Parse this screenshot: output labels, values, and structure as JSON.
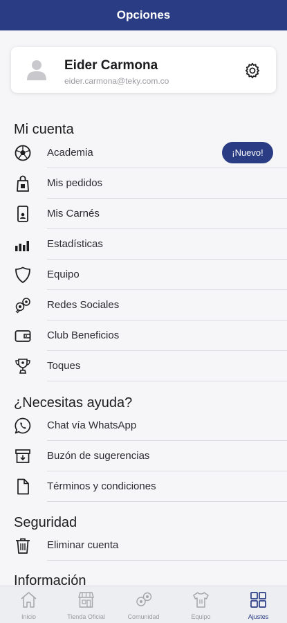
{
  "header": {
    "title": "Opciones"
  },
  "profile": {
    "name": "Eider Carmona",
    "email": "eider.carmona@teky.com.co",
    "avatar_icon": "user-icon",
    "settings_icon": "gear-icon"
  },
  "sections": {
    "mi_cuenta": {
      "title": "Mi cuenta",
      "items": [
        {
          "label": "Academia",
          "icon": "soccer-ball-icon",
          "badge": "¡Nuevo!"
        },
        {
          "label": "Mis pedidos",
          "icon": "shopping-bag-icon"
        },
        {
          "label": "Mis Carnés",
          "icon": "id-card-icon"
        },
        {
          "label": "Estadísticas",
          "icon": "bar-chart-icon"
        },
        {
          "label": "Equipo",
          "icon": "shield-icon"
        },
        {
          "label": "Redes Sociales",
          "icon": "social-network-icon"
        },
        {
          "label": "Club Beneficios",
          "icon": "wallet-icon"
        },
        {
          "label": "Toques",
          "icon": "trophy-icon"
        }
      ]
    },
    "ayuda": {
      "title": "¿Necesitas ayuda?",
      "items": [
        {
          "label": "Chat vía WhatsApp",
          "icon": "whatsapp-icon"
        },
        {
          "label": "Buzón de sugerencias",
          "icon": "inbox-icon"
        },
        {
          "label": "Términos y condiciones",
          "icon": "document-icon"
        }
      ]
    },
    "seguridad": {
      "title": "Seguridad",
      "items": [
        {
          "label": "Eliminar cuenta",
          "icon": "trash-icon"
        }
      ]
    },
    "informacion": {
      "title": "Información"
    }
  },
  "bottom_nav": {
    "active": "Ajustes",
    "tabs": [
      {
        "label": "Inicio",
        "icon": "home-icon"
      },
      {
        "label": "Tienda Oficial",
        "icon": "store-icon"
      },
      {
        "label": "Comunidad",
        "icon": "community-icon"
      },
      {
        "label": "Equipo",
        "icon": "jersey-icon"
      },
      {
        "label": "Ajustes",
        "icon": "grid-icon"
      }
    ]
  },
  "colors": {
    "primary": "#2a3c84",
    "background": "#f6f6f8",
    "muted_text": "#9a9aa2"
  }
}
